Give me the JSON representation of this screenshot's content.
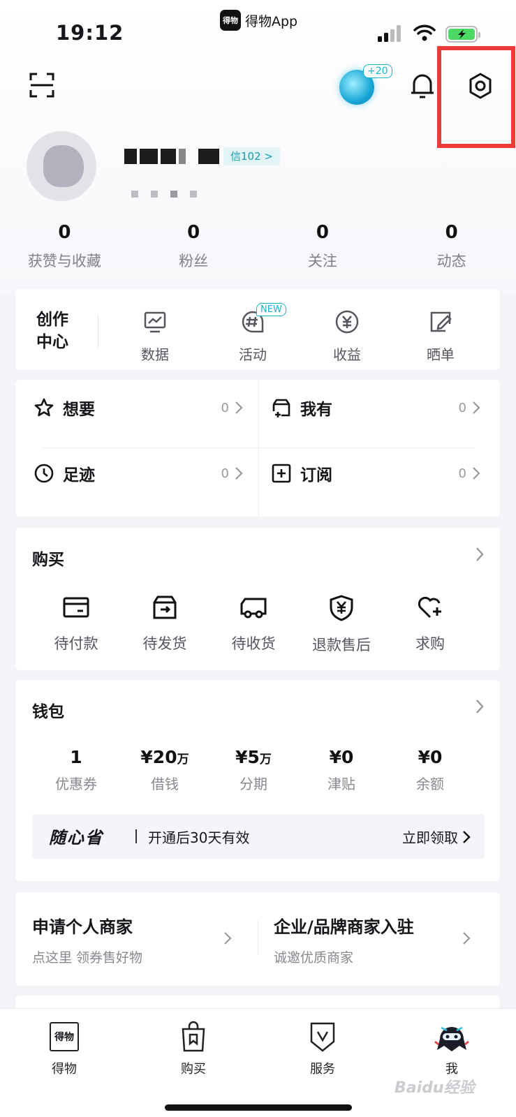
{
  "status_bar": {
    "time": "19:12",
    "app_name": "得物App",
    "app_logo_text": "得物"
  },
  "header": {
    "gem_badge": "+20"
  },
  "profile": {
    "level_tag": "信102 >"
  },
  "stats": [
    {
      "value": "0",
      "label": "获赞与收藏"
    },
    {
      "value": "0",
      "label": "粉丝"
    },
    {
      "value": "0",
      "label": "关注"
    },
    {
      "value": "0",
      "label": "动态"
    }
  ],
  "creator": {
    "title": "创作中心",
    "items": [
      {
        "label": "数据"
      },
      {
        "label": "活动",
        "tag": "NEW"
      },
      {
        "label": "收益"
      },
      {
        "label": "晒单"
      }
    ]
  },
  "lists": {
    "want": {
      "label": "想要",
      "count": "0"
    },
    "have": {
      "label": "我有",
      "count": "0"
    },
    "history": {
      "label": "足迹",
      "count": "0"
    },
    "subscribe": {
      "label": "订阅",
      "count": "0"
    }
  },
  "buy": {
    "title": "购买",
    "items": [
      {
        "label": "待付款"
      },
      {
        "label": "待发货"
      },
      {
        "label": "待收货"
      },
      {
        "label": "退款售后"
      },
      {
        "label": "求购"
      }
    ]
  },
  "wallet": {
    "title": "钱包",
    "items": [
      {
        "value": "1",
        "unit": "",
        "label": "优惠券"
      },
      {
        "value": "¥20",
        "unit": "万",
        "label": "借钱"
      },
      {
        "value": "¥5",
        "unit": "万",
        "label": "分期"
      },
      {
        "value": "¥0",
        "unit": "",
        "label": "津贴"
      },
      {
        "value": "¥0",
        "unit": "",
        "label": "余额"
      }
    ],
    "promo": {
      "brand": "随心省",
      "desc": "开通后30天有效",
      "action": "立即领取"
    }
  },
  "merchant": {
    "personal": {
      "title": "申请个人商家",
      "sub": "点这里 领券售好物"
    },
    "enterprise": {
      "title": "企业/品牌商家入驻",
      "sub": "诚邀优质商家"
    }
  },
  "tabbar": [
    {
      "label": "得物",
      "icon_text": "得物"
    },
    {
      "label": "购买"
    },
    {
      "label": "服务"
    },
    {
      "label": "我"
    }
  ],
  "watermark": "Baidu经验"
}
